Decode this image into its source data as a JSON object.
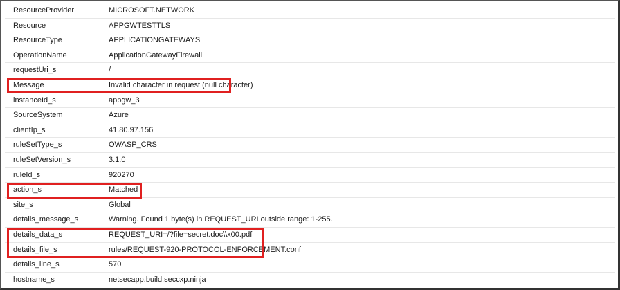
{
  "rows": [
    {
      "key": "ResourceProvider",
      "value": "MICROSOFT.NETWORK"
    },
    {
      "key": "Resource",
      "value": "APPGWTESTTLS"
    },
    {
      "key": "ResourceType",
      "value": "APPLICATIONGATEWAYS"
    },
    {
      "key": "OperationName",
      "value": "ApplicationGatewayFirewall"
    },
    {
      "key": "requestUri_s",
      "value": "/"
    },
    {
      "key": "Message",
      "value": "Invalid character in request (null character)"
    },
    {
      "key": "instanceId_s",
      "value": "appgw_3"
    },
    {
      "key": "SourceSystem",
      "value": "Azure"
    },
    {
      "key": "clientIp_s",
      "value": "41.80.97.156"
    },
    {
      "key": "ruleSetType_s",
      "value": "OWASP_CRS"
    },
    {
      "key": "ruleSetVersion_s",
      "value": "3.1.0"
    },
    {
      "key": "ruleId_s",
      "value": "920270"
    },
    {
      "key": "action_s",
      "value": "Matched"
    },
    {
      "key": "site_s",
      "value": "Global"
    },
    {
      "key": "details_message_s",
      "value": "Warning. Found 1 byte(s) in REQUEST_URI outside range: 1-255."
    },
    {
      "key": "details_data_s",
      "value": "REQUEST_URI=/?file=secret.doc\\\\x00.pdf"
    },
    {
      "key": "details_file_s",
      "value": "rules/REQUEST-920-PROTOCOL-ENFORCEMENT.conf"
    },
    {
      "key": "details_line_s",
      "value": "570"
    },
    {
      "key": "hostname_s",
      "value": "netsecapp.build.seccxp.ninja"
    }
  ],
  "highlight_color": "#e02020"
}
